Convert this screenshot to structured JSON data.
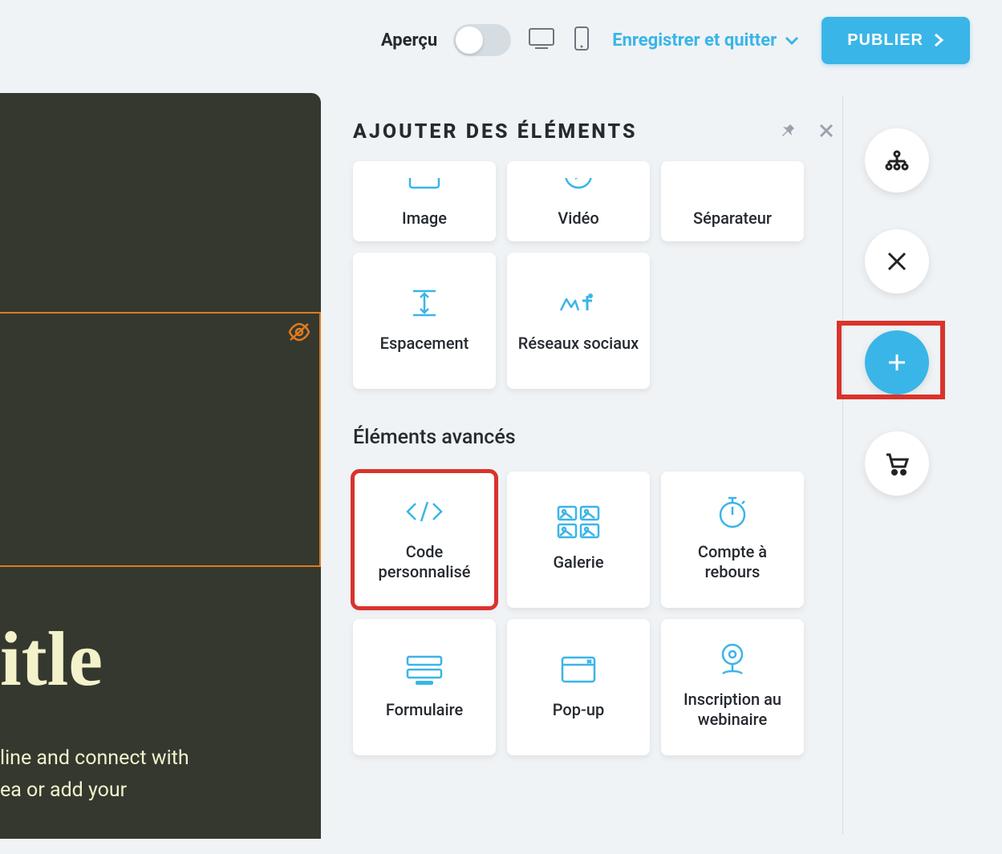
{
  "topbar": {
    "apercu_label": "Aperçu",
    "save_quit_label": "Enregistrer et quitter",
    "publish_label": "PUBLIER"
  },
  "canvas": {
    "title_fragment": "itle",
    "subtitle_line1": "line and connect with",
    "subtitle_line2": "ea or add your"
  },
  "panel": {
    "title": "Ajouter des éléments",
    "section_advanced": "Éléments avancés",
    "tiles_basic": [
      {
        "label": "Image"
      },
      {
        "label": "Vidéo"
      },
      {
        "label": "Séparateur"
      },
      {
        "label": "Espacement"
      },
      {
        "label": "Réseaux sociaux"
      }
    ],
    "tiles_advanced": [
      {
        "label": "Code personnalisé"
      },
      {
        "label": "Galerie"
      },
      {
        "label": "Compte à rebours"
      },
      {
        "label": "Formulaire"
      },
      {
        "label": "Pop-up"
      },
      {
        "label": "Inscription au webinaire"
      }
    ]
  },
  "colors": {
    "accent": "#3ab5e8",
    "canvas_bg": "#35382f",
    "highlight_red": "#d9332b",
    "outline_orange": "#e07b1f"
  }
}
